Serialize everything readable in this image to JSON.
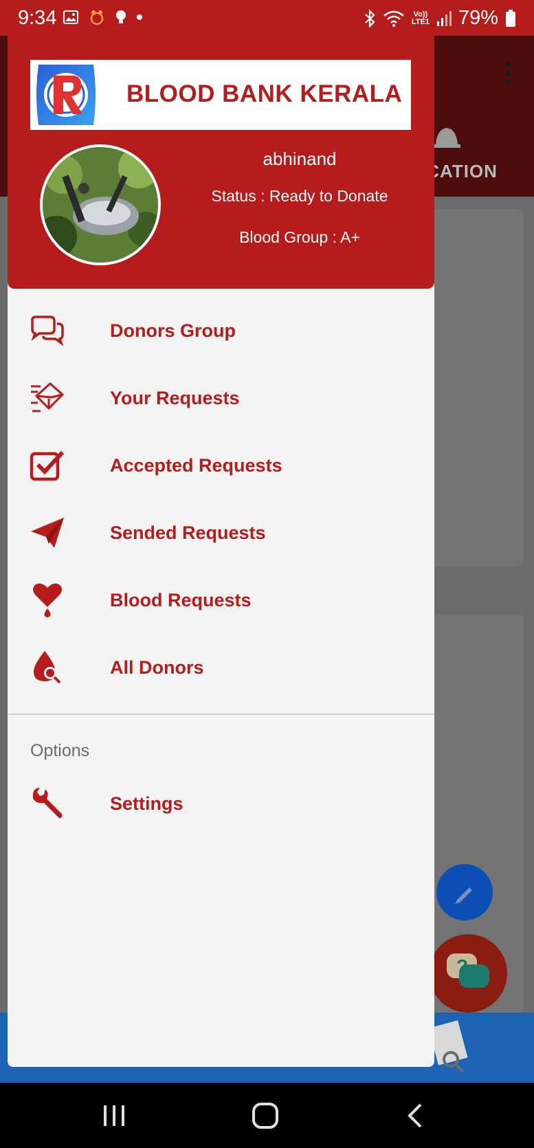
{
  "status_bar": {
    "time": "9:34",
    "battery": "79%",
    "lte_top": "Vo))",
    "lte_bottom": "LTE1",
    "left_icons": [
      "gallery-icon",
      "app-icon",
      "bulb-icon",
      "dot-icon"
    ],
    "right_icons": [
      "bluetooth-icon",
      "wifi-icon",
      "signal-icon",
      "battery-icon"
    ]
  },
  "drawer": {
    "brand": {
      "title": "BLOOD BANK KERALA",
      "logo": "blood-bank-logo"
    },
    "user": {
      "name": "abhinand",
      "status": "Status : Ready to Donate",
      "blood_group": "Blood Group : A+"
    },
    "menu": [
      {
        "label": "Donors Group",
        "icon": "chat-bubbles-icon"
      },
      {
        "label": "Your Requests",
        "icon": "envelope-send-icon"
      },
      {
        "label": "Accepted Requests",
        "icon": "checkbox-icon"
      },
      {
        "label": "Sended Requests",
        "icon": "paper-plane-icon"
      },
      {
        "label": "Blood Requests",
        "icon": "heart-drop-icon"
      },
      {
        "label": "All Donors",
        "icon": "drop-search-icon"
      }
    ],
    "options_title": "Options",
    "settings": {
      "label": "Settings",
      "icon": "wrench-icon"
    }
  },
  "background": {
    "tab_text": "ICATION"
  },
  "colors": {
    "primary": "#b71c1c",
    "drawer_bg": "#f3f3f3",
    "scrim": "#6b6b6b"
  }
}
